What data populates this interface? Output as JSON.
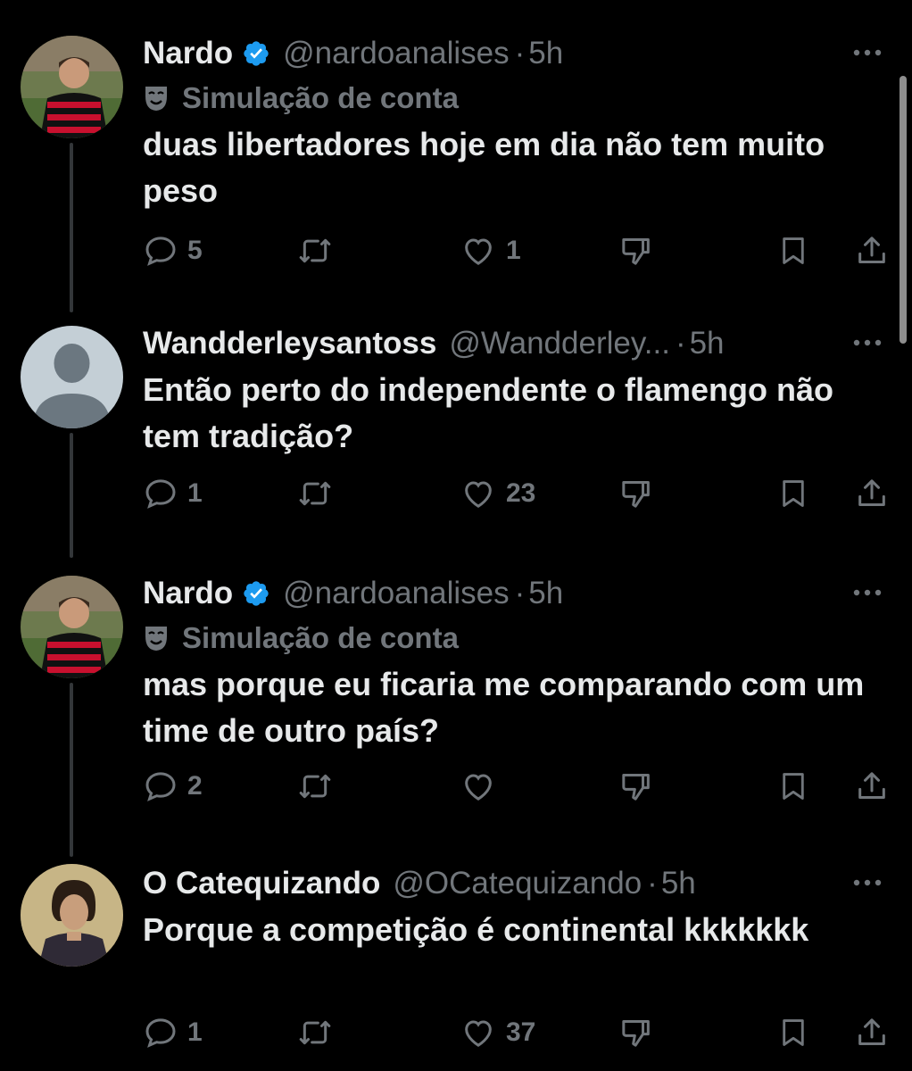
{
  "tweets": [
    {
      "name": "Nardo",
      "verified": true,
      "handle": "@nardoanalises",
      "dot": "·",
      "time": "5h",
      "badge_icon": "theater-mask-icon",
      "badge_label": "Simulação de conta",
      "text": "duas libertadores hoje em dia não tem muito peso",
      "replies": "5",
      "retweets": "",
      "likes": "1"
    },
    {
      "name": "Wandderleysantoss",
      "verified": false,
      "handle": "@Wandderley...",
      "dot": "·",
      "time": "5h",
      "text": "Então perto do independente o flamengo não tem tradição?",
      "replies": "1",
      "retweets": "",
      "likes": "23"
    },
    {
      "name": "Nardo",
      "verified": true,
      "handle": "@nardoanalises",
      "dot": "·",
      "time": "5h",
      "badge_icon": "theater-mask-icon",
      "badge_label": "Simulação de conta",
      "text": "mas porque eu ficaria me comparando com um time de outro país?",
      "replies": "2",
      "retweets": "",
      "likes": ""
    },
    {
      "name": "O Catequizando",
      "verified": false,
      "handle": "@OCatequizando",
      "dot": "·",
      "time": "5h",
      "text": "Porque a competição é continental kkkkkkk",
      "replies": "1",
      "retweets": "",
      "likes": "37"
    }
  ],
  "colors": {
    "background": "#000000",
    "text": "#e7e9ea",
    "secondary": "#71767b",
    "verified": "#1d9bf0",
    "thread_line": "#333639"
  },
  "icons": [
    "reply-icon",
    "retweet-icon",
    "like-icon",
    "dislike-icon",
    "bookmark-icon",
    "share-icon",
    "more-icon",
    "verified-badge-icon"
  ]
}
